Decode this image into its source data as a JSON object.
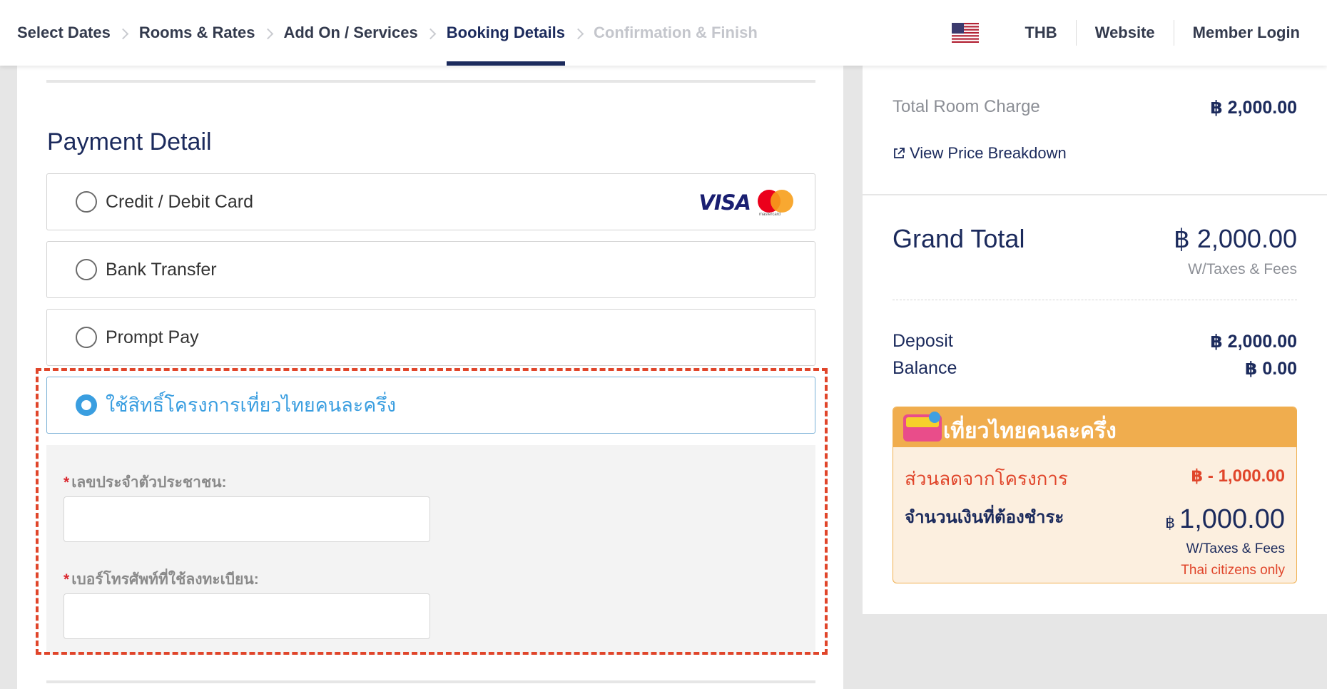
{
  "nav": {
    "steps": [
      {
        "label": "Select Dates",
        "state": "done"
      },
      {
        "label": "Rooms & Rates",
        "state": "done"
      },
      {
        "label": "Add On / Services",
        "state": "done"
      },
      {
        "label": "Booking Details",
        "state": "active"
      },
      {
        "label": "Confirmation & Finish",
        "state": "disabled"
      }
    ],
    "flag_icon": "us-flag-icon",
    "currency": "THB",
    "website": "Website",
    "member_login": "Member Login"
  },
  "payment": {
    "title": "Payment Detail",
    "options": [
      {
        "label": "Credit / Debit Card",
        "selected": false
      },
      {
        "label": "Bank Transfer",
        "selected": false
      },
      {
        "label": "Prompt Pay",
        "selected": false
      },
      {
        "label": "ใช้สิทธิ์โครงการเที่ยวไทยคนละครึ่ง",
        "selected": true
      }
    ],
    "card_brands": {
      "visa": "VISA",
      "mastercard": "mastercard"
    },
    "form": {
      "required_mark": "*",
      "id_label": "เลขประจำตัวประชาชน:",
      "id_value": "",
      "phone_label": "เบอร์โทรศัพท์ที่ใช้ลงทะเบียน:",
      "phone_value": ""
    }
  },
  "summary": {
    "total_room_charge_label": "Total Room Charge",
    "total_room_charge_value": "฿ 2,000.00",
    "view_breakdown": "View Price Breakdown",
    "grand_total_label": "Grand Total",
    "grand_total_value": "฿ 2,000.00",
    "taxes_note": "W/Taxes & Fees",
    "deposit_label": "Deposit",
    "deposit_value": "฿ 2,000.00",
    "balance_label": "Balance",
    "balance_value": "฿ 0.00"
  },
  "promo": {
    "title": "เที่ยวไทยคนละครึ่ง",
    "discount_label": "ส่วนลดจากโครงการ",
    "discount_value": "฿ - 1,000.00",
    "pay_label": "จำนวนเงินที่ต้องชำระ",
    "pay_currency": "฿",
    "pay_amount": "1,000.00",
    "taxes_note": "W/Taxes & Fees",
    "citizens_note": "Thai citizens only"
  },
  "colors": {
    "navy": "#1b2a5c",
    "accent_blue": "#3a9ee0",
    "highlight_red": "#e0452a",
    "promo_orange": "#f0ad4e"
  }
}
